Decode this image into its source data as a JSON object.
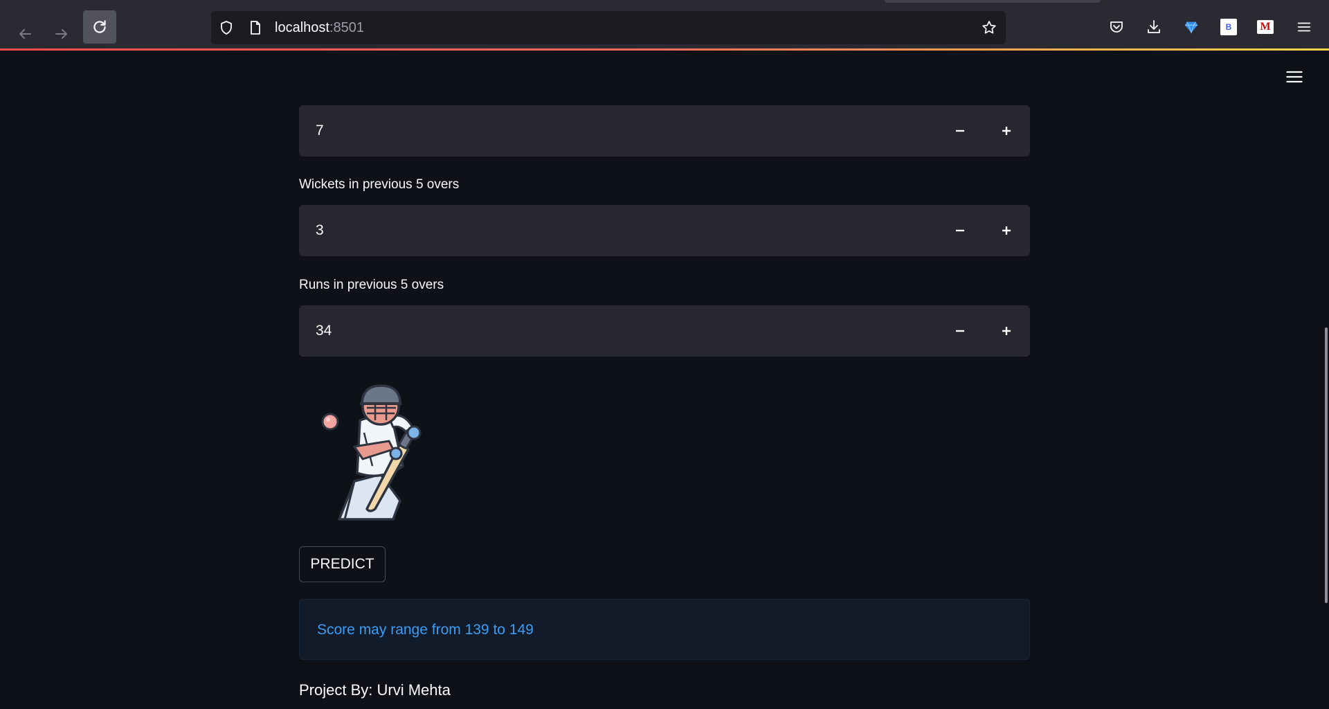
{
  "browser": {
    "url_host": "localhost",
    "url_port": ":8501",
    "extensions": {
      "b_label": "B",
      "m_label": "M"
    },
    "icons": [
      "back-arrow-icon",
      "forward-arrow-icon",
      "reload-icon",
      "shield-icon",
      "page-icon",
      "star-icon",
      "pocket-icon",
      "download-icon",
      "gem-icon",
      "menu-icon"
    ]
  },
  "app": {
    "menu_icon": "hamburger-icon",
    "fields": [
      {
        "label": "",
        "value": "7"
      },
      {
        "label": "Wickets in previous 5 overs",
        "value": "3"
      },
      {
        "label": "Runs in previous 5 overs",
        "value": "34"
      }
    ],
    "stepper": {
      "minus_icon": "minus-icon",
      "plus_icon": "plus-icon"
    },
    "predict_label": "PREDICT",
    "result_text": "Score may range from 139 to 149",
    "footer_text": "Project By: Urvi Mehta"
  },
  "colors": {
    "background": "#0e1117",
    "input_bg": "#262730",
    "info_text": "#3d9df3",
    "info_bg": "#111b2a"
  }
}
